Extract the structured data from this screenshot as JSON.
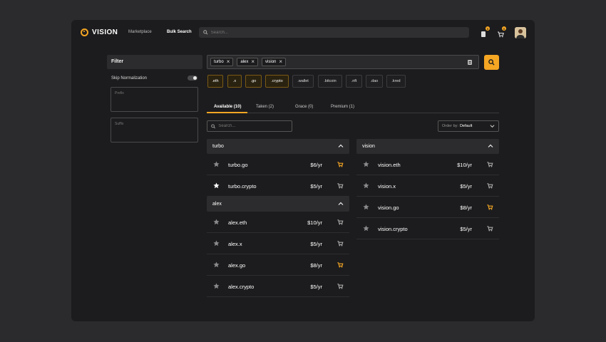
{
  "header": {
    "logo_text": "VISION",
    "nav": [
      {
        "label": "Marketplace",
        "active": false
      },
      {
        "label": "Bulk Search",
        "active": true
      }
    ],
    "search_placeholder": "Search...",
    "notifications_count": "0",
    "cart_count": "0"
  },
  "filter": {
    "title": "Filter",
    "skip_normalization_label": "Skip Normalization",
    "prefix_placeholder": "Prefix",
    "suffix_placeholder": "Suffix"
  },
  "query_chips": [
    "turbo",
    "alex",
    "vision"
  ],
  "tlds": [
    {
      "label": ".eth",
      "selected": true
    },
    {
      "label": ".x",
      "selected": true
    },
    {
      "label": ".go",
      "selected": true
    },
    {
      "label": ".crypto",
      "selected": true
    },
    {
      "label": ".wallet",
      "selected": false
    },
    {
      "label": ".bitcoin",
      "selected": false
    },
    {
      "label": ".nft",
      "selected": false
    },
    {
      "label": ".dao",
      "selected": false
    },
    {
      "label": ".kred",
      "selected": false
    }
  ],
  "tabs": [
    {
      "label": "Available (10)",
      "active": true
    },
    {
      "label": "Taken (2)",
      "active": false
    },
    {
      "label": "Grace (0)",
      "active": false
    },
    {
      "label": "Premium (1)",
      "active": false
    }
  ],
  "results_search_placeholder": "Search...",
  "order_by": {
    "label": "Order by:",
    "value": "Default"
  },
  "groups": [
    {
      "name": "turbo",
      "rows": [
        {
          "domain": "turbo.go",
          "price": "$6/yr",
          "starred": false,
          "in_cart": true
        },
        {
          "domain": "turbo.crypto",
          "price": "$5/yr",
          "starred": true,
          "in_cart": false
        }
      ]
    },
    {
      "name": "alex",
      "rows": [
        {
          "domain": "alex.eth",
          "price": "$10/yr",
          "starred": false,
          "in_cart": false
        },
        {
          "domain": "alex.x",
          "price": "$5/yr",
          "starred": false,
          "in_cart": false
        },
        {
          "domain": "alex.go",
          "price": "$8/yr",
          "starred": false,
          "in_cart": true
        },
        {
          "domain": "alex.crypto",
          "price": "$5/yr",
          "starred": false,
          "in_cart": false
        }
      ]
    },
    {
      "name": "vision",
      "rows": [
        {
          "domain": "vision.eth",
          "price": "$10/yr",
          "starred": false,
          "in_cart": false
        },
        {
          "domain": "vision.x",
          "price": "$5/yr",
          "starred": false,
          "in_cart": false
        },
        {
          "domain": "vision.go",
          "price": "$8/yr",
          "starred": false,
          "in_cart": true
        },
        {
          "domain": "vision.crypto",
          "price": "$5/yr",
          "starred": false,
          "in_cart": false
        }
      ]
    }
  ],
  "colors": {
    "accent": "#f5a623",
    "background": "#1c1c1e",
    "panel": "#2c2c2e"
  }
}
